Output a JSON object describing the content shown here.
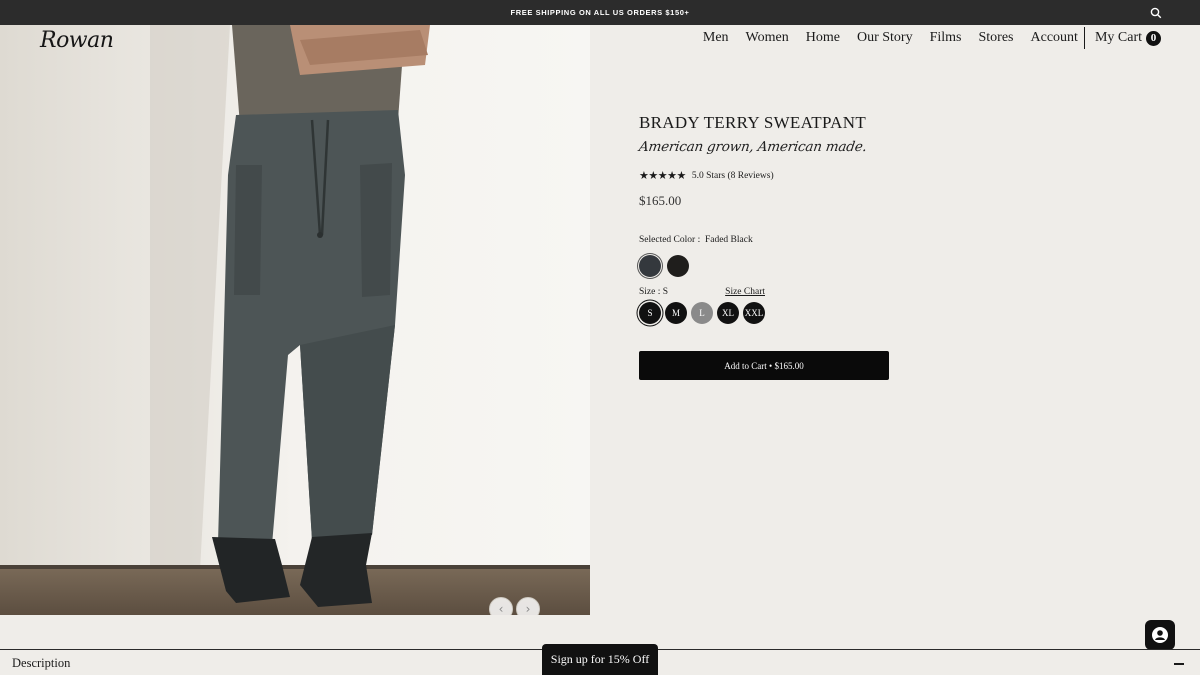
{
  "announcement": {
    "text": "FREE SHIPPING ON ALL US ORDERS $150+",
    "search_icon": "search-icon"
  },
  "brand": {
    "logo": "Rowan"
  },
  "nav": {
    "items": [
      "Men",
      "Women",
      "Home",
      "Our Story",
      "Films",
      "Stores",
      "Account"
    ],
    "cart_label": "My Cart",
    "cart_count": "0"
  },
  "gallery": {
    "prev_icon": "chevron-left-icon",
    "next_icon": "chevron-right-icon"
  },
  "product": {
    "title": "BRADY TERRY SWEATPANT",
    "tagline": "American grown, American made.",
    "stars_text": "★★★★★",
    "rating_text": "5.0 Stars (8 Reviews)",
    "rating_value": 5,
    "price": "$165.00",
    "selected_color_label": "Selected Color :",
    "selected_color": "Faded Black",
    "colors": [
      {
        "name": "Faded Black",
        "hex": "#34383d",
        "selected": true
      },
      {
        "name": "Black",
        "hex": "#1f1e1c",
        "selected": false
      }
    ],
    "size_label": "Size : S",
    "size_chart": "Size Chart",
    "sizes": [
      {
        "label": "S",
        "selected": true,
        "available": true
      },
      {
        "label": "M",
        "selected": false,
        "available": true
      },
      {
        "label": "L",
        "selected": false,
        "available": false
      },
      {
        "label": "XL",
        "selected": false,
        "available": true
      },
      {
        "label": "XXL",
        "selected": false,
        "available": true
      }
    ],
    "add_to_cart": "Add to Cart • $165.00"
  },
  "footer": {
    "description_label": "Description",
    "signup_label": "Sign up for 15% Off",
    "collapse_icon": "minus-icon",
    "chat_icon": "chat-avatar-icon"
  }
}
